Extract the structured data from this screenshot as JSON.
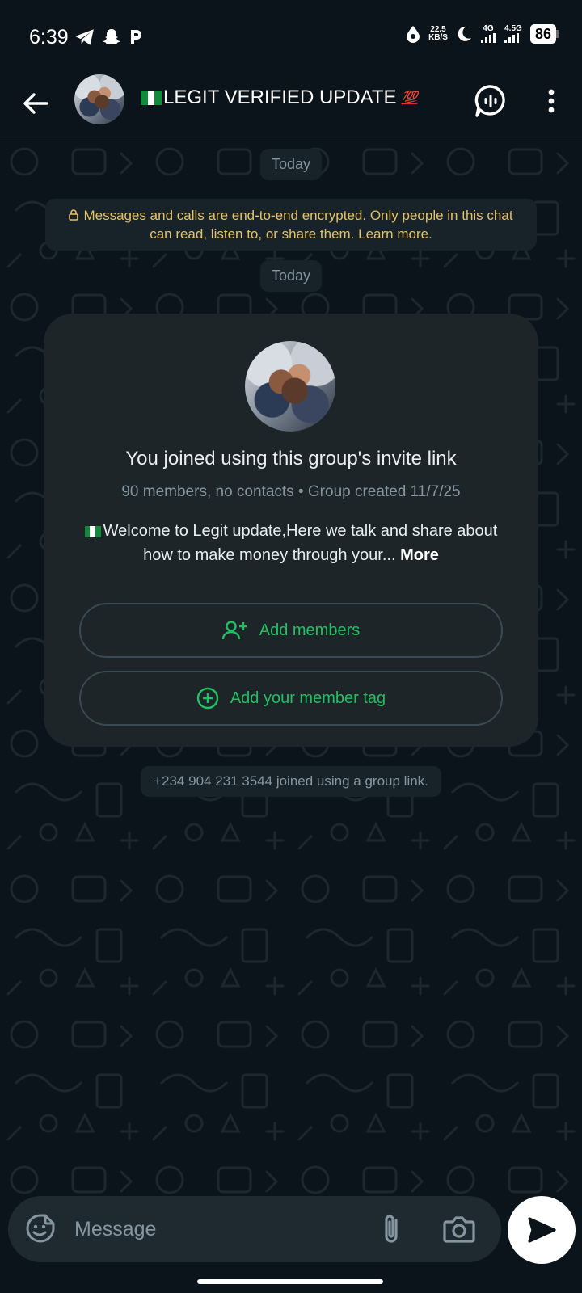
{
  "status_bar": {
    "time": "6:39",
    "speed_value": "22.5",
    "speed_unit": "KB/S",
    "net1": "4G",
    "net2": "4.5G",
    "battery": "86"
  },
  "header": {
    "title": "LEGIT VERIFIED UPDATE",
    "emoji": "💯"
  },
  "chat": {
    "date_chip_1": "Today",
    "encryption_note": "Messages and calls are end-to-end encrypted. Only people in this chat can read, listen to, or share them. Learn more.",
    "date_chip_2": "Today",
    "group_card": {
      "title": "You joined using this group's invite link",
      "meta": "90 members, no contacts • Group created 11/7/25",
      "description": "Welcome to Legit update,Here we talk and share about how to make money through your...",
      "more_label": "More",
      "add_members_label": "Add members",
      "add_tag_label": "Add your member tag"
    },
    "system_message": "+234 904 231 3544 joined using a group link."
  },
  "input": {
    "placeholder": "Message"
  },
  "colors": {
    "background": "#0b141a",
    "accent": "#21c063",
    "encryption_text": "#e6c066"
  }
}
